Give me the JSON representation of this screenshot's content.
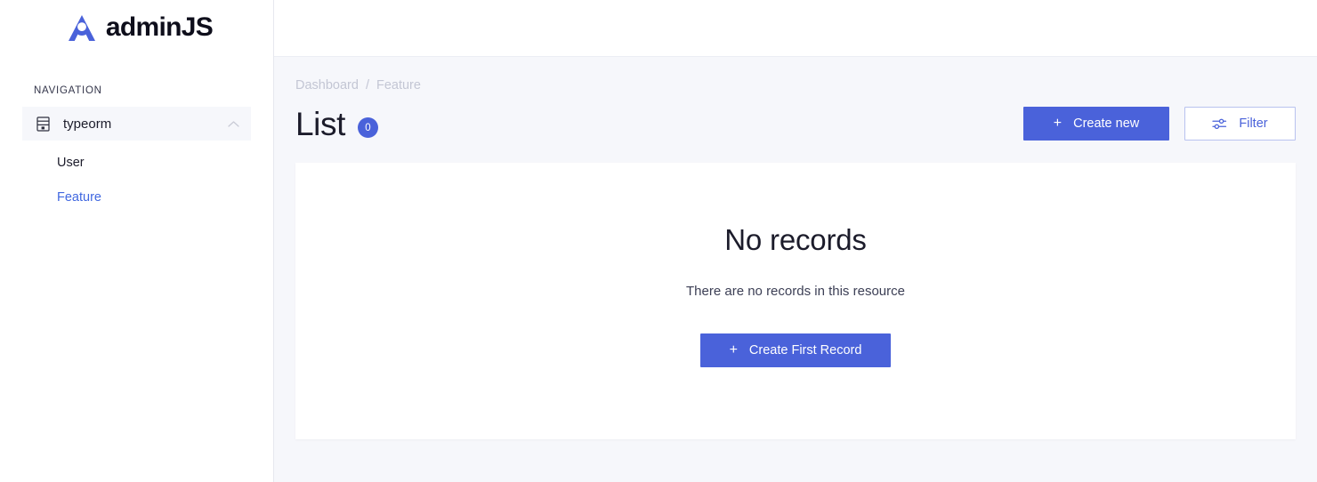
{
  "brand": {
    "name": "adminJS",
    "logo_icon": "adminjs-logo-icon",
    "logo_color": "#4a62da"
  },
  "sidebar": {
    "section_label": "NAVIGATION",
    "group": {
      "label": "typeorm",
      "icon": "database-icon",
      "chevron_icon": "chevron-up-icon",
      "expanded": true
    },
    "items": [
      {
        "label": "User",
        "active": false
      },
      {
        "label": "Feature",
        "active": true
      }
    ]
  },
  "breadcrumb": {
    "items": [
      "Dashboard",
      "Feature"
    ],
    "separator": "/"
  },
  "page": {
    "title": "List",
    "count": "0"
  },
  "toolbar": {
    "create_new_label": "Create new",
    "create_new_icon": "plus-icon",
    "filter_label": "Filter",
    "filter_icon": "sliders-icon"
  },
  "empty_state": {
    "title": "No records",
    "subtitle": "There are no records in this resource",
    "button_label": "Create First Record",
    "button_icon": "plus-icon"
  },
  "colors": {
    "accent": "#4a62da",
    "link": "#4168e0",
    "page_background": "#f6f7fb",
    "card_background": "#ffffff",
    "muted_text": "#c3c6d4"
  }
}
